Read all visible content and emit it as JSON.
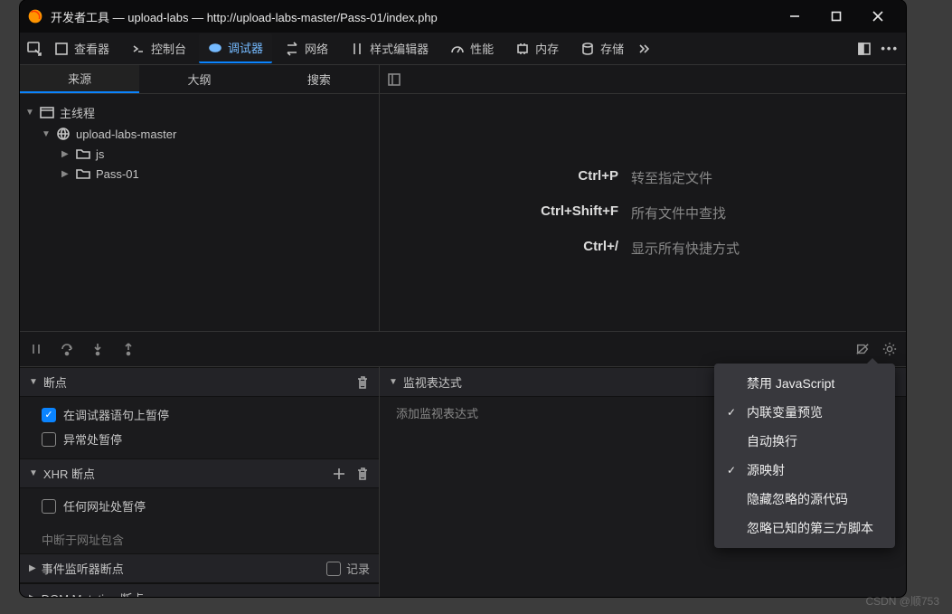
{
  "titlebar": {
    "app": "开发者工具",
    "project": "upload-labs",
    "url": "http://upload-labs-master/Pass-01/index.php"
  },
  "toolbar": {
    "tabs": [
      "查看器",
      "控制台",
      "调试器",
      "网络",
      "样式编辑器",
      "性能",
      "内存",
      "存储"
    ],
    "active_index": 2
  },
  "source_tabs": {
    "items": [
      "来源",
      "大纲",
      "搜索"
    ],
    "active": 0
  },
  "tree": {
    "root": "主线程",
    "host": "upload-labs-master",
    "folders": [
      "js",
      "Pass-01"
    ]
  },
  "shortcuts": [
    {
      "keys": "Ctrl+P",
      "desc": "转至指定文件"
    },
    {
      "keys": "Ctrl+Shift+F",
      "desc": "所有文件中查找"
    },
    {
      "keys": "Ctrl+/",
      "desc": "显示所有快捷方式"
    }
  ],
  "breakpoints": {
    "title": "断点",
    "items": [
      {
        "label": "在调试器语句上暂停",
        "checked": true
      },
      {
        "label": "异常处暂停",
        "checked": false
      }
    ]
  },
  "xhr": {
    "title": "XHR 断点",
    "any": {
      "label": "任何网址处暂停",
      "checked": false
    },
    "placeholder": "中断于网址包含"
  },
  "listeners": {
    "title": "事件监听器断点",
    "record": "记录"
  },
  "dom": {
    "title": "DOM Mutation 断点"
  },
  "watch": {
    "title": "监视表达式",
    "placeholder": "添加监视表达式"
  },
  "settings_menu": [
    {
      "label": "禁用 JavaScript",
      "checked": false
    },
    {
      "label": "内联变量预览",
      "checked": true
    },
    {
      "label": "自动换行",
      "checked": false
    },
    {
      "label": "源映射",
      "checked": true
    },
    {
      "label": "隐藏忽略的源代码",
      "checked": false
    },
    {
      "label": "忽略已知的第三方脚本",
      "checked": false
    }
  ],
  "watermark": "CSDN @顺753"
}
